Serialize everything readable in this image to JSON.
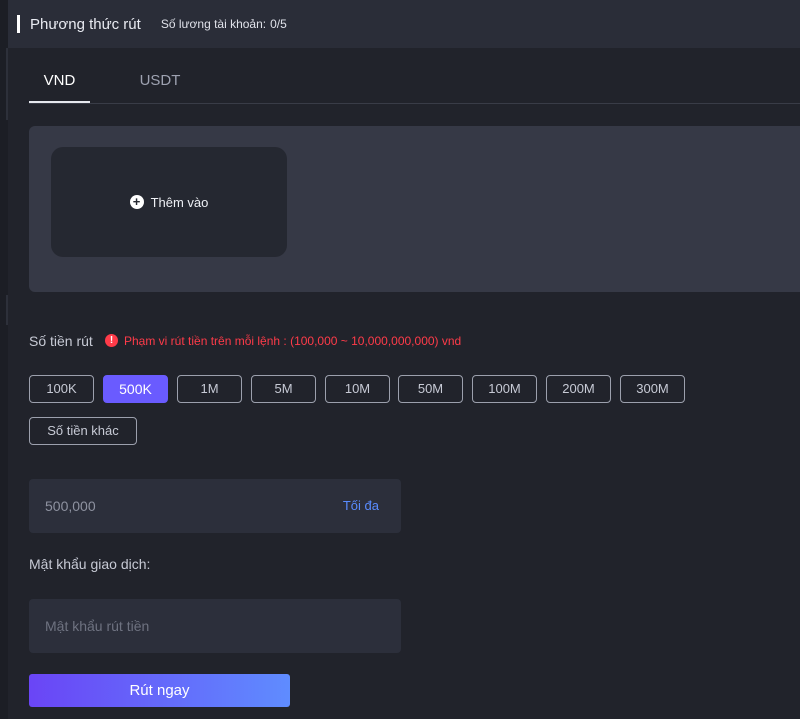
{
  "header": {
    "title": "Phương thức rút",
    "account_count_label": "Số lương tài khoản:",
    "account_count_value": "0/5"
  },
  "tabs": [
    {
      "label": "VND",
      "active": true
    },
    {
      "label": "USDT",
      "active": false
    }
  ],
  "card_area": {
    "add_label": "Thêm vào",
    "add_icon": "plus-circle-icon"
  },
  "amount": {
    "label": "Số tiền rút",
    "warning_icon": "alert-circle-icon",
    "range_text": "Phạm vi rút tiền trên mỗi lệnh : (100,000 ~ 10,000,000,000) vnd",
    "presets": [
      "100K",
      "500K",
      "1M",
      "5M",
      "10M",
      "50M",
      "100M",
      "200M",
      "300M"
    ],
    "selected_preset": "500K",
    "other_label": "Số tiền khác",
    "value": "500,000",
    "max_label": "Tối đa"
  },
  "password": {
    "label": "Mật khẩu giao dịch:",
    "placeholder": "Mật khẩu rút tiền"
  },
  "submit_label": "Rút ngay",
  "colors": {
    "accent": "#6a5bff",
    "warning": "#ff3b49",
    "link": "#5a8cff",
    "background": "#21232b"
  }
}
